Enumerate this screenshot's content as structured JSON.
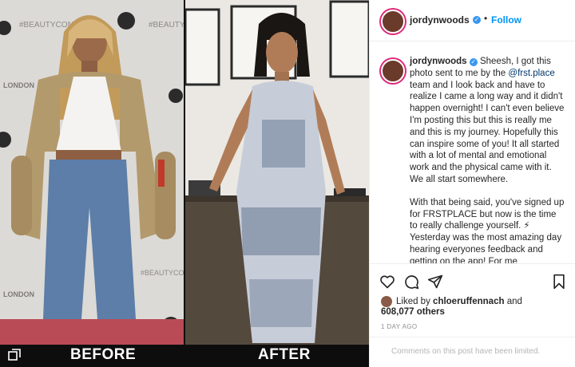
{
  "media": {
    "before_label": "BEFORE",
    "after_label": "AFTER",
    "backdrop_texts": [
      "#BEAUTYCON",
      "#BEAUTY",
      "LONDON",
      "#BEAUTYCON",
      "LONDON"
    ]
  },
  "post": {
    "username": "jordynwoods",
    "follow_label": "Follow",
    "dot": "•",
    "caption": {
      "username": "jordynwoods",
      "text_before_mention": "Sheesh, I got this photo sent to me by the ",
      "mention": "@frst.place",
      "text_after_mention": " team and I look back and have to realize I came a long way and it didn't happen overnight! I can't even believe I'm posting this but this is really me and this is my journey. Hopefully this can inspire some of you! It all started with a lot of mental and emotional work and the physical came with it. We all start somewhere.",
      "paragraph_2": "With that being said, you've signed up for FRSTPLACE but now is the time to really challenge yourself. ⚡ Yesterday was the most amazing day hearing everyones feedback and getting on the app! For me transformation was a gradual change"
    },
    "likes": {
      "prefix": "Liked by",
      "user": "chloeruffennach",
      "suffix": "and",
      "count": "608,077 others"
    },
    "timestamp": "1 DAY AGO",
    "comments_limited": "Comments on this post have been limited."
  },
  "colors": {
    "accent": "#0095f6",
    "verified": "#3897f0",
    "story_ring": "#dd2a7b"
  }
}
